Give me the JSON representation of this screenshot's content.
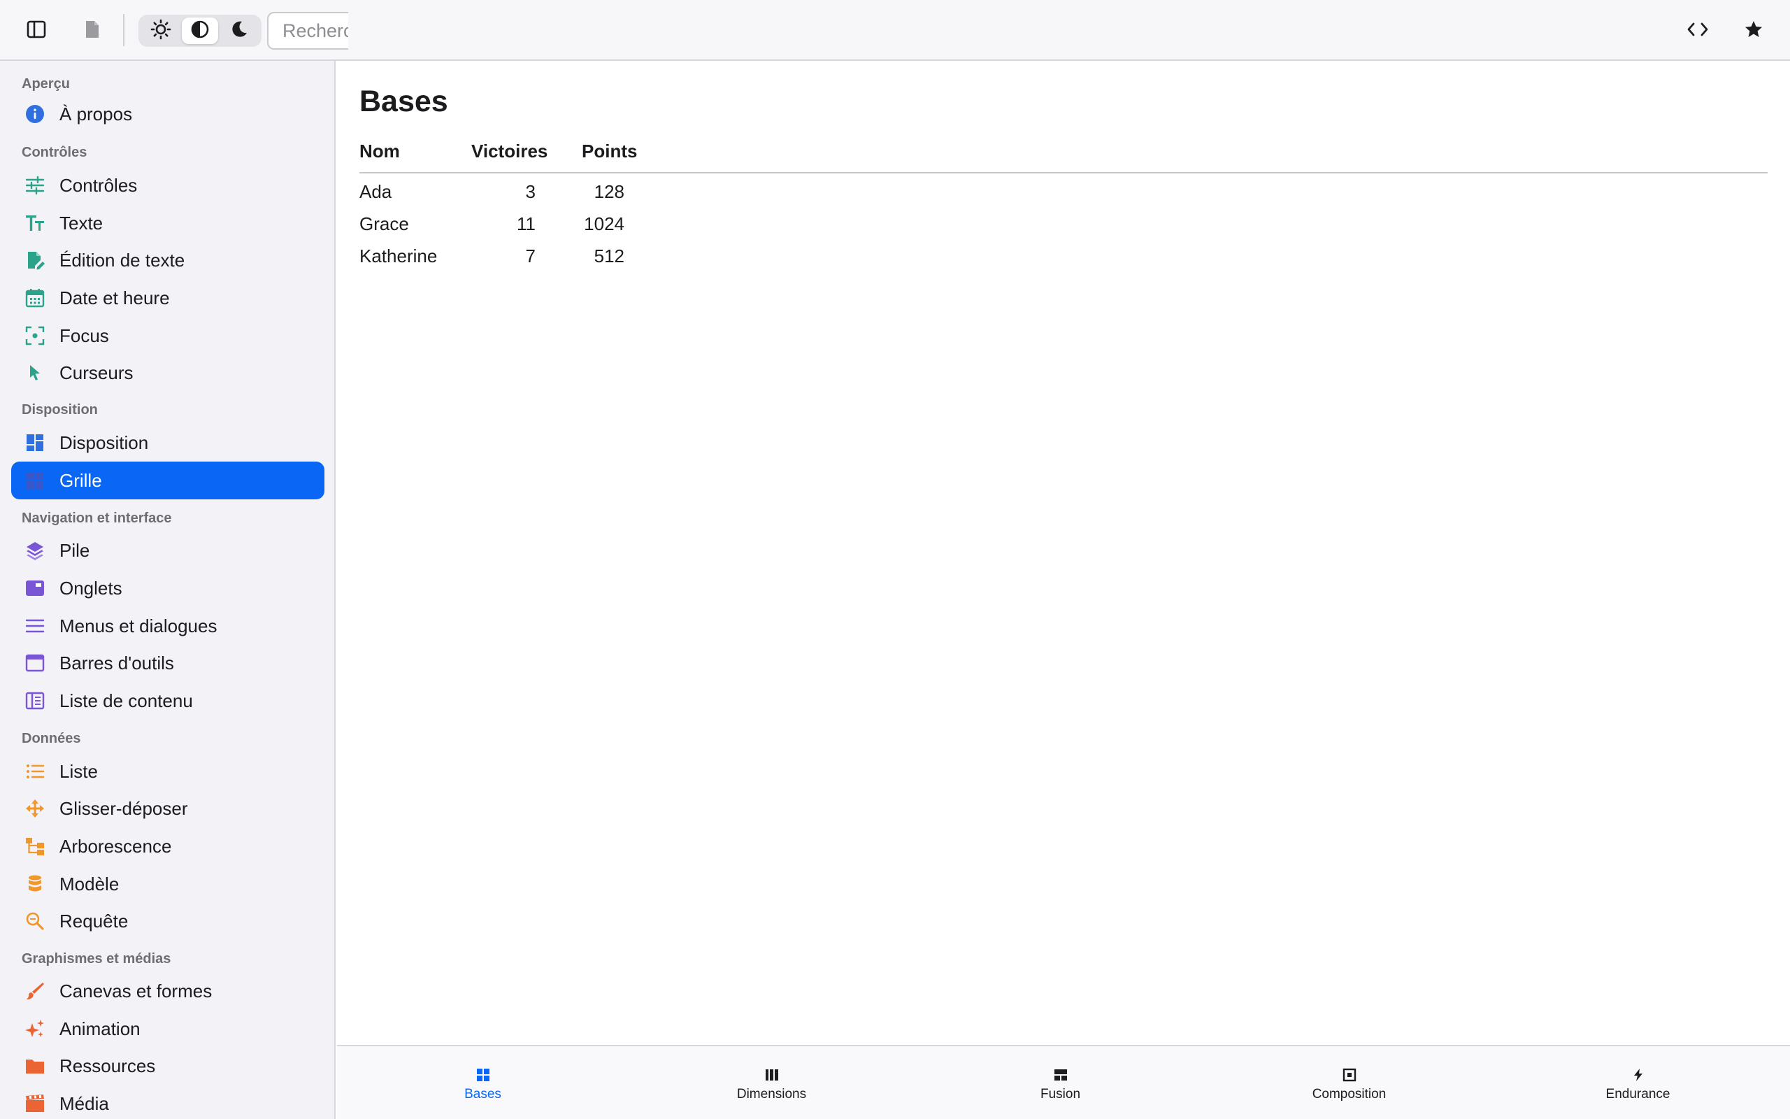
{
  "toolbar": {
    "search_placeholder": "Rechercher",
    "appearance_modes": [
      "light",
      "auto",
      "dark"
    ],
    "active_mode": "auto"
  },
  "sidebar": {
    "sections": [
      {
        "title": "Aperçu",
        "items": [
          {
            "label": "À propos",
            "icon": "info-icon",
            "color": "#2f6fe0"
          }
        ]
      },
      {
        "title": "Contrôles",
        "items": [
          {
            "label": "Contrôles",
            "icon": "sliders-icon",
            "color": "#2aa38a"
          },
          {
            "label": "Texte",
            "icon": "text-size-icon",
            "color": "#2aa38a"
          },
          {
            "label": "Édition de texte",
            "icon": "document-edit-icon",
            "color": "#2aa38a"
          },
          {
            "label": "Date et heure",
            "icon": "calendar-icon",
            "color": "#2aa38a"
          },
          {
            "label": "Focus",
            "icon": "focus-icon",
            "color": "#2aa38a"
          },
          {
            "label": "Curseurs",
            "icon": "cursor-arrow-icon",
            "color": "#2aa38a"
          }
        ]
      },
      {
        "title": "Disposition",
        "items": [
          {
            "label": "Disposition",
            "icon": "layout-grid-icon",
            "color": "#2f6fe0"
          },
          {
            "label": "Grille",
            "icon": "grid-icon",
            "color": "#2f6fe0",
            "selected": true
          }
        ]
      },
      {
        "title": "Navigation et interface",
        "items": [
          {
            "label": "Pile",
            "icon": "stack-layers-icon",
            "color": "#7a55d6"
          },
          {
            "label": "Onglets",
            "icon": "tabs-icon",
            "color": "#7a55d6"
          },
          {
            "label": "Menus et dialogues",
            "icon": "menu-lines-icon",
            "color": "#7a55d6"
          },
          {
            "label": "Barres d'outils",
            "icon": "toolbar-window-icon",
            "color": "#7a55d6"
          },
          {
            "label": "Liste de contenu",
            "icon": "content-list-icon",
            "color": "#7a55d6"
          }
        ]
      },
      {
        "title": "Données",
        "items": [
          {
            "label": "Liste",
            "icon": "list-icon",
            "color": "#f0962a"
          },
          {
            "label": "Glisser-déposer",
            "icon": "drag-move-icon",
            "color": "#f0962a"
          },
          {
            "label": "Arborescence",
            "icon": "tree-icon",
            "color": "#f0962a"
          },
          {
            "label": "Modèle",
            "icon": "database-icon",
            "color": "#f0962a"
          },
          {
            "label": "Requête",
            "icon": "search-query-icon",
            "color": "#f0962a"
          }
        ]
      },
      {
        "title": "Graphismes et médias",
        "items": [
          {
            "label": "Canevas et formes",
            "icon": "brush-icon",
            "color": "#ea6434"
          },
          {
            "label": "Animation",
            "icon": "sparkles-icon",
            "color": "#ea6434"
          },
          {
            "label": "Ressources",
            "icon": "folder-icon",
            "color": "#ea6434"
          },
          {
            "label": "Média",
            "icon": "film-icon",
            "color": "#ea6434"
          }
        ]
      }
    ]
  },
  "main": {
    "title": "Bases",
    "table": {
      "headers": [
        "Nom",
        "Victoires",
        "Points"
      ],
      "rows": [
        [
          "Ada",
          "3",
          "128"
        ],
        [
          "Grace",
          "11",
          "1024"
        ],
        [
          "Katherine",
          "7",
          "512"
        ]
      ]
    }
  },
  "tabbar": {
    "tabs": [
      {
        "label": "Bases",
        "icon": "grid-four-icon",
        "active": true
      },
      {
        "label": "Dimensions",
        "icon": "columns-icon"
      },
      {
        "label": "Fusion",
        "icon": "merge-layout-icon"
      },
      {
        "label": "Composition",
        "icon": "square-inset-icon"
      },
      {
        "label": "Endurance",
        "icon": "bolt-icon"
      }
    ]
  },
  "colors": {
    "accent": "#0a66f5",
    "sidebar_bg": "#f2f2f7"
  }
}
